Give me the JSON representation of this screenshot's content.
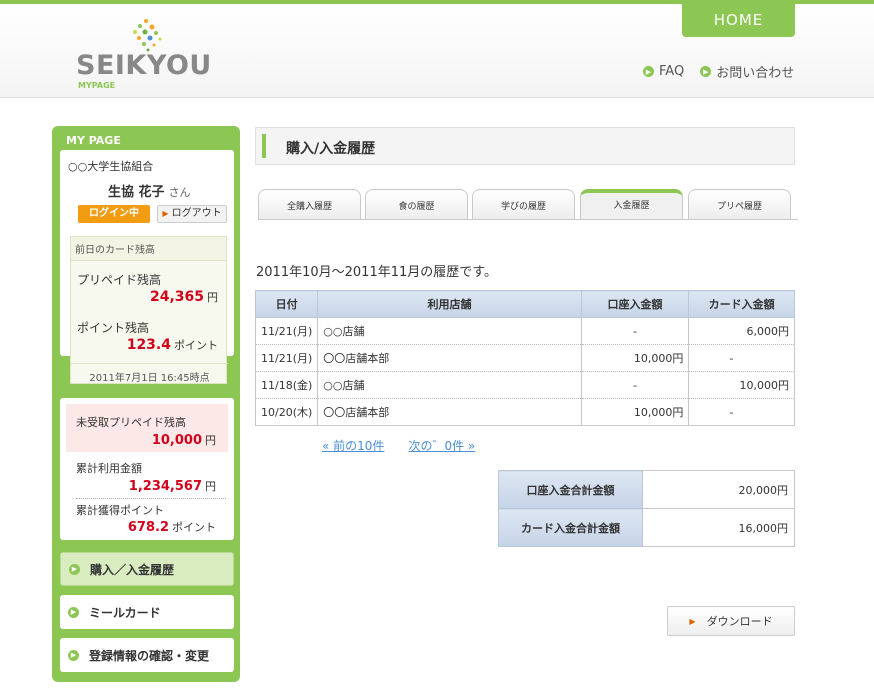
{
  "header": {
    "logo_text": "SEIKYOU",
    "logo_sub": "MYPAGE",
    "home_label": "HOME",
    "links": [
      {
        "label": "FAQ",
        "icon": "arrow-circle-icon"
      },
      {
        "label": "お問い合わせ",
        "icon": "arrow-circle-icon"
      }
    ],
    "accent_color": "#8cc653"
  },
  "sidebar": {
    "title": "MY PAGE",
    "user": {
      "university": "○○大学生協組合",
      "name": "生協 花子",
      "honorific": "さん",
      "login_status": "ログイン中",
      "logout_label": "ログアウト"
    },
    "balance": {
      "heading": "前日のカード残高",
      "prepaid_label": "プリペイド残高",
      "prepaid_value": "24,365",
      "prepaid_unit": "円",
      "points_label": "ポイント残高",
      "points_value": "123.4",
      "points_unit": "ポイント",
      "as_of": "2011年7月1日 16:45時点"
    },
    "stats": {
      "unreceived_label": "未受取プリペイド残高",
      "unreceived_value": "10,000",
      "unreceived_unit": "円",
      "total_used_label": "累計利用金額",
      "total_used_value": "1,234,567",
      "total_used_unit": "円",
      "total_points_label": "累計獲得ポイント",
      "total_points_value": "678.2",
      "total_points_unit": "ポイント"
    },
    "menu": [
      {
        "label": "購入／入金履歴",
        "active": true
      },
      {
        "label": "ミールカード",
        "active": false
      },
      {
        "label": "登録情報の確認・変更",
        "active": false
      }
    ]
  },
  "main": {
    "page_title": "購入/入金履歴",
    "tabs": [
      {
        "label": "全購入履歴"
      },
      {
        "label": "食の履歴"
      },
      {
        "label": "学びの履歴"
      },
      {
        "label": "入金履歴",
        "active": true
      },
      {
        "label": "プリペ履歴"
      }
    ],
    "period_text": "2011年10月～2011年11月の履歴です。",
    "table": {
      "headers": [
        "日付",
        "利用店舗",
        "口座入金額",
        "カード入金額"
      ],
      "rows": [
        {
          "date": "11/21(月)",
          "store": "○○店舗",
          "account": "-",
          "card": "6,000円"
        },
        {
          "date": "11/21(月)",
          "store": "〇〇店舗本部",
          "account": "10,000円",
          "card": "-"
        },
        {
          "date": "11/18(金)",
          "store": "○○店舗",
          "account": "-",
          "card": "10,000円"
        },
        {
          "date": "10/20(木)",
          "store": "〇〇店舗本部",
          "account": "10,000円",
          "card": "-"
        }
      ]
    },
    "pager": {
      "prev": "« 前の10件",
      "next": "次の゛0件 »"
    },
    "totals": {
      "account_label": "口座入金合計金額",
      "account_value": "20,000円",
      "card_label": "カード入金合計金額",
      "card_value": "16,000円"
    },
    "download_label": "ダウンロード"
  }
}
